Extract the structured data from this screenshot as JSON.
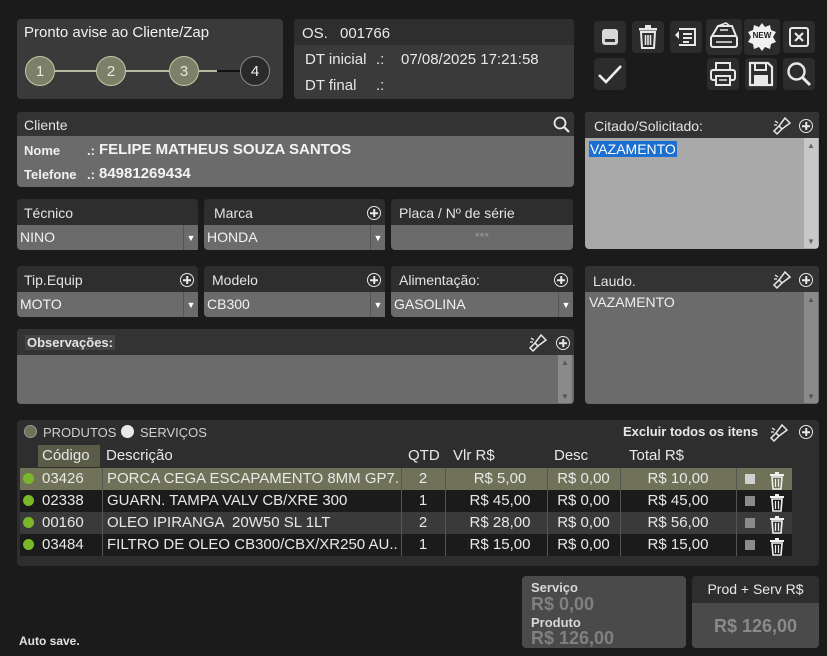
{
  "status": {
    "title": "Pronto avise ao Cliente/Zap",
    "steps": [
      "1",
      "2",
      "3",
      "4"
    ]
  },
  "os": {
    "label": "OS.",
    "number": "001766",
    "dt_inicial_label": "DT inicial",
    "dt_inicial_sep": ".:",
    "dt_inicial_value": "07/08/2025 17:21:58",
    "dt_final_label": "DT final",
    "dt_final_sep": ".:"
  },
  "toolbar": {
    "new_badge": "NEW"
  },
  "cliente": {
    "title": "Cliente",
    "nome_label": "Nome",
    "nome_sep": ".:",
    "nome_value": "FELIPE MATHEUS SOUZA SANTOS",
    "telefone_label": "Telefone",
    "telefone_sep": ".:",
    "telefone_value": "84981269434"
  },
  "citado": {
    "title": "Citado/Solicitado:",
    "value": "VAZAMENTO"
  },
  "tecnico": {
    "label": "Técnico",
    "value": "NINO"
  },
  "marca": {
    "label": "Marca",
    "value": "HONDA"
  },
  "placa": {
    "label": "Placa / Nº de série",
    "placeholder": "***"
  },
  "tip_equip": {
    "label": "Tip.Equip",
    "value": "MOTO"
  },
  "modelo": {
    "label": "Modelo",
    "value": "CB300"
  },
  "alimentacao": {
    "label": "Alimentação:",
    "value": "GASOLINA"
  },
  "laudo": {
    "title": "Laudo.",
    "value": "VAZAMENTO"
  },
  "observacoes": {
    "title": "Observações:",
    "value": ""
  },
  "items": {
    "radio_produtos": "PRODUTOS",
    "radio_servicos": "SERVIÇOS",
    "excluir_todos": "Excluir todos os itens",
    "columns": [
      "Código",
      "Descrição",
      "QTD",
      "Vlr R$",
      "Desc",
      "Total R$"
    ],
    "rows": [
      {
        "codigo": "03426",
        "descricao": "PORCA CEGA ESCAPAMENTO 8MM GP7...",
        "qtd": "2",
        "vlr": "R$ 5,00",
        "desc": "R$ 0,00",
        "total": "R$ 10,00"
      },
      {
        "codigo": "02338",
        "descricao": "GUARN. TAMPA VALV CB/XRE 300",
        "qtd": "1",
        "vlr": "R$ 45,00",
        "desc": "R$ 0,00",
        "total": "R$ 45,00"
      },
      {
        "codigo": "00160",
        "descricao": "OLEO IPIRANGA  20W50 SL 1LT",
        "qtd": "2",
        "vlr": "R$ 28,00",
        "desc": "R$ 0,00",
        "total": "R$ 56,00"
      },
      {
        "codigo": "03484",
        "descricao": "FILTRO DE OLEO CB300/CBX/XR250 AU...",
        "qtd": "1",
        "vlr": "R$ 15,00",
        "desc": "R$ 0,00",
        "total": "R$ 15,00"
      }
    ]
  },
  "totals": {
    "servico_label": "Serviço",
    "servico_value": "R$ 0,00",
    "produto_label": "Produto",
    "produto_value": "R$ 126,00",
    "prod_serv_label": "Prod + Serv R$",
    "prod_serv_value": "R$ 126,00"
  },
  "footer": {
    "autosave": "Auto save."
  },
  "colors": {
    "step_active": "#7b8068",
    "step_current": "#2a2a2a",
    "selected_row": "#6f7258",
    "status_dot": "#7ab82a",
    "selection_highlight": "#1a6fd0"
  }
}
